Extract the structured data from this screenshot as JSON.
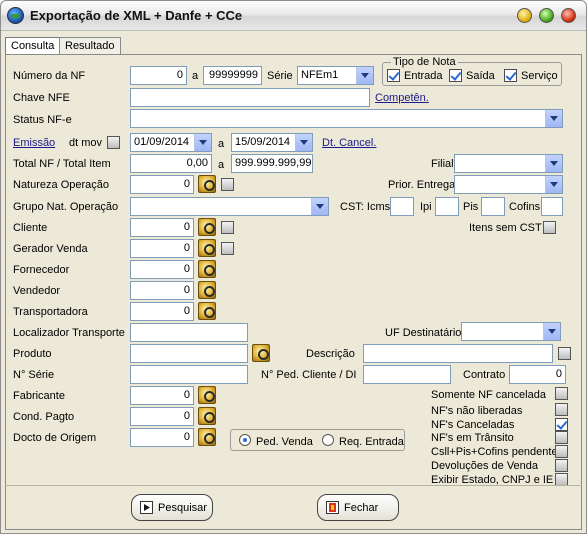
{
  "window": {
    "title": "Exportação de XML + Danfe + CCe"
  },
  "tabs": [
    {
      "label": "Consulta"
    },
    {
      "label": "Resultado"
    }
  ],
  "form": {
    "numero_nf": {
      "label": "Número da NF",
      "from": "0",
      "sep": "a",
      "to": "99999999"
    },
    "serie": {
      "label": "Série",
      "value": "NFEm1"
    },
    "tipo_nota": {
      "label": "Tipo de Nota",
      "entrada": "Entrada",
      "saida": "Saída",
      "servico": "Serviço"
    },
    "chave_nfe": {
      "label": "Chave NFE",
      "value": ""
    },
    "competen": {
      "label": "Competên."
    },
    "status_nfe": {
      "label": "Status NF-e",
      "value": ""
    },
    "emissao": {
      "label": "Emissão",
      "dtmov": "dt mov",
      "from": "01/09/2014",
      "sep": "a",
      "to": "15/09/2014",
      "dt_cancel": "Dt. Cancel."
    },
    "total_nf": {
      "label": "Total NF / Total Item",
      "from": "0,00",
      "sep": "a",
      "to": "999.999.999,99"
    },
    "filial": {
      "label": "Filial",
      "value": ""
    },
    "natureza": {
      "label": "Natureza Operação",
      "value": "0"
    },
    "prior_entrega": {
      "label": "Prior. Entrega",
      "value": ""
    },
    "grupo_nat": {
      "label": "Grupo Nat. Operação",
      "value": ""
    },
    "cst": {
      "label": "CST: Icms",
      "ipi": "Ipi",
      "pis": "Pis",
      "cofins": "Cofins"
    },
    "cliente": {
      "label": "Cliente",
      "value": "0"
    },
    "itens_sem_cst": {
      "label": "Itens sem CST"
    },
    "gerador_venda": {
      "label": "Gerador Venda",
      "value": "0"
    },
    "fornecedor": {
      "label": "Fornecedor",
      "value": "0"
    },
    "vendedor": {
      "label": "Vendedor",
      "value": "0"
    },
    "transportadora": {
      "label": "Transportadora",
      "value": "0"
    },
    "localizador": {
      "label": "Localizador Transporte",
      "value": ""
    },
    "uf_destinatario": {
      "label": "UF Destinatário",
      "value": ""
    },
    "produto": {
      "label": "Produto",
      "value": ""
    },
    "descricao": {
      "label": "Descrição",
      "value": ""
    },
    "n_serie": {
      "label": "N° Série",
      "value": ""
    },
    "n_ped_cliente": {
      "label": "N° Ped. Cliente / DI",
      "value": ""
    },
    "contrato": {
      "label": "Contrato",
      "value": "0"
    },
    "fabricante": {
      "label": "Fabricante",
      "value": "0"
    },
    "cond_pagto": {
      "label": "Cond. Pagto",
      "value": "0"
    },
    "docto_origem": {
      "label": "Docto de Origem",
      "value": "0"
    },
    "ped_venda": "Ped. Venda",
    "req_entrada": "Req. Entrada"
  },
  "options": [
    {
      "label": "Somente NF cancelada",
      "checked": false
    },
    {
      "label": "NF's não liberadas",
      "checked": false
    },
    {
      "label": "NF's Canceladas",
      "checked": true
    },
    {
      "label": "NF's em Trânsito",
      "checked": false
    },
    {
      "label": "Csll+Pis+Cofins pendente",
      "checked": false
    },
    {
      "label": "Devoluções de Venda",
      "checked": false
    },
    {
      "label": "Exibir Estado, CNPJ e IE",
      "checked": false
    }
  ],
  "buttons": {
    "pesquisar": "Pesquisar",
    "fechar": "Fechar"
  }
}
